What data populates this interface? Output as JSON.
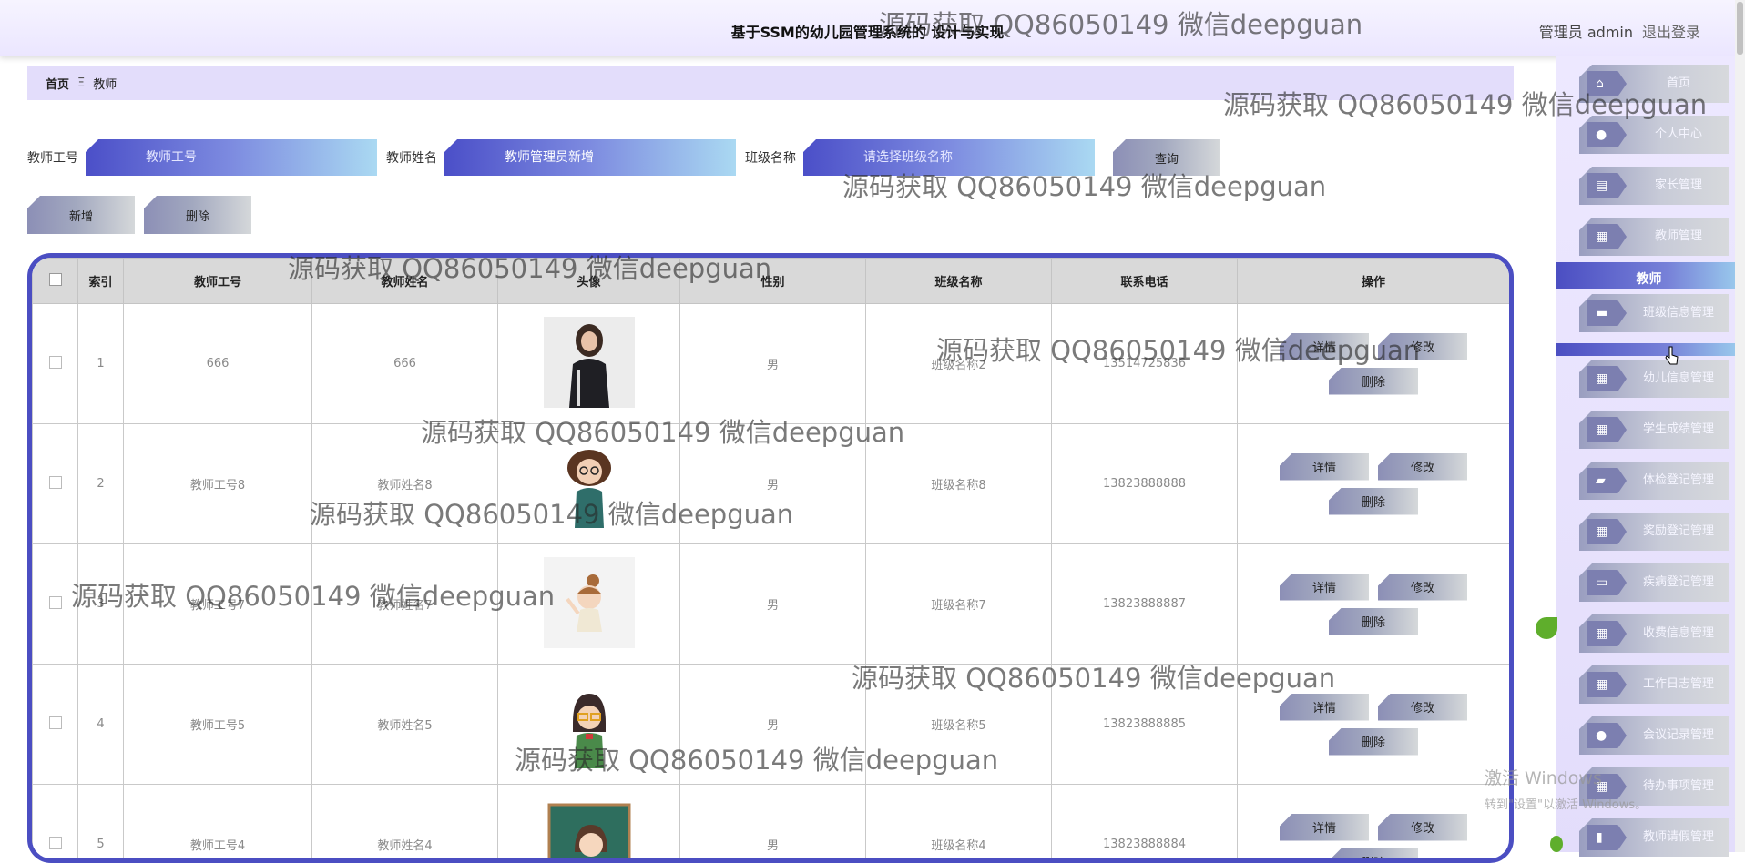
{
  "header": {
    "title": "基于SSM的幼儿园管理系统的 设计与实现",
    "user": "管理员 admin",
    "logout": "退出登录"
  },
  "breadcrumb": {
    "home": "首页",
    "separator": "Ξ",
    "current": "教师"
  },
  "search": {
    "teacher_id_label": "教师工号",
    "teacher_id_placeholder": "教师工号",
    "teacher_name_label": "教师姓名",
    "teacher_name_value": "教师管理员新增",
    "class_label": "班级名称",
    "class_placeholder": "请选择班级名称",
    "query_button": "查询"
  },
  "actions": {
    "add": "新增",
    "delete": "删除"
  },
  "table": {
    "columns": [
      "索引",
      "教师工号",
      "教师姓名",
      "头像",
      "性别",
      "班级名称",
      "联系电话",
      "操作"
    ],
    "rows": [
      {
        "index": "1",
        "id": "666",
        "name": "666",
        "gender": "男",
        "class": "班级名称2",
        "phone": "13514725836"
      },
      {
        "index": "2",
        "id": "教师工号8",
        "name": "教师姓名8",
        "gender": "男",
        "class": "班级名称8",
        "phone": "13823888888"
      },
      {
        "index": "3",
        "id": "教师工号7",
        "name": "教师姓名7",
        "gender": "男",
        "class": "班级名称7",
        "phone": "13823888887"
      },
      {
        "index": "4",
        "id": "教师工号5",
        "name": "教师姓名5",
        "gender": "男",
        "class": "班级名称5",
        "phone": "13823888885"
      },
      {
        "index": "5",
        "id": "教师工号4",
        "name": "教师姓名4",
        "gender": "男",
        "class": "班级名称4",
        "phone": "13823888884"
      }
    ],
    "op_labels": {
      "detail": "详情",
      "edit": "修改",
      "delete": "删除"
    }
  },
  "sidebar": {
    "items_top": [
      {
        "label": "首页",
        "icon": "home-icon"
      },
      {
        "label": "个人中心",
        "icon": "user-icon"
      },
      {
        "label": "家长管理",
        "icon": "clipboard-icon"
      },
      {
        "label": "教师管理",
        "icon": "grid-icon"
      }
    ],
    "group_label": "教师",
    "items_mid": [
      {
        "label": "班级信息管理",
        "icon": "ticket-icon"
      }
    ],
    "items_bottom": [
      {
        "label": "幼儿信息管理",
        "icon": "grid-icon"
      },
      {
        "label": "学生成绩管理",
        "icon": "grid-icon"
      },
      {
        "label": "体检登记管理",
        "icon": "briefcase-icon"
      },
      {
        "label": "奖励登记管理",
        "icon": "grid-icon"
      },
      {
        "label": "疾病登记管理",
        "icon": "monitor-icon"
      },
      {
        "label": "收费信息管理",
        "icon": "grid-icon"
      },
      {
        "label": "工作日志管理",
        "icon": "grid-icon"
      },
      {
        "label": "会议记录管理",
        "icon": "user-icon"
      },
      {
        "label": "待办事项管理",
        "icon": "grid-icon"
      },
      {
        "label": "教师请假管理",
        "icon": "chart-icon"
      }
    ]
  },
  "watermark": "源码获取 QQ86050149 微信deepguan",
  "windows_activation": {
    "line1": "激活 Windows",
    "line2": "转到\"设置\"以激活 Windows。"
  },
  "colors": {
    "accent": "#4b4ec2",
    "sidebar_bg": "#ebe6ff",
    "breadcrumb_bg": "#e3ddfb"
  }
}
